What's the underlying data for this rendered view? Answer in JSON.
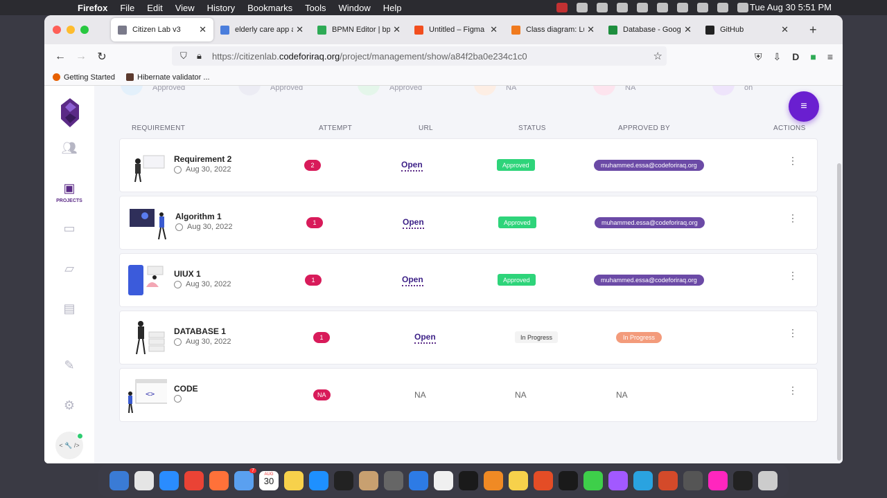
{
  "menubar": {
    "app": "Firefox",
    "items": [
      "File",
      "Edit",
      "View",
      "History",
      "Bookmarks",
      "Tools",
      "Window",
      "Help"
    ],
    "clock": "Tue Aug 30  5:51 PM"
  },
  "tabs": [
    {
      "label": "Citizen Lab v3",
      "color": "#7a7a8a",
      "active": true
    },
    {
      "label": "elderly care app an",
      "color": "#4a7ddc"
    },
    {
      "label": "BPMN Editor | bpm",
      "color": "#2eaa55"
    },
    {
      "label": "Untitled – Figma",
      "color": "#f24e1e"
    },
    {
      "label": "Class diagram: Luc",
      "color": "#f07a1e"
    },
    {
      "label": "Database - Google",
      "color": "#1e8e3e"
    },
    {
      "label": "GitHub",
      "color": "#222222"
    }
  ],
  "url": {
    "prefix": "https://citizenlab.",
    "domain": "codeforiraq.org",
    "path": "/project/management/show/a84f2ba0e234c1c0"
  },
  "bookmarks": [
    "Getting Started",
    "Hibernate validator ..."
  ],
  "sidebar": {
    "active_label": "PROJECTS"
  },
  "avatar_text": "< 🔧 />",
  "topstrip": [
    "Approved",
    "Approved",
    "Approved",
    "NA",
    "NA",
    "on"
  ],
  "table": {
    "headers": [
      "REQUIREMENT",
      "ATTEMPT",
      "URL",
      "STATUS",
      "APPROVED BY",
      "ACTIONS"
    ],
    "rows": [
      {
        "name": "Requirement 2",
        "date": "Aug 30, 2022",
        "attempt": "2",
        "url": "Open",
        "status": "Approved",
        "status_type": "approved",
        "approved_by": "muhammed.essa@codeforiraq.org",
        "approver_type": "email"
      },
      {
        "name": "Algorithm 1",
        "date": "Aug 30, 2022",
        "attempt": "1",
        "url": "Open",
        "status": "Approved",
        "status_type": "approved",
        "approved_by": "muhammed.essa@codeforiraq.org",
        "approver_type": "email"
      },
      {
        "name": "UIUX 1",
        "date": "Aug 30, 2022",
        "attempt": "1",
        "url": "Open",
        "status": "Approved",
        "status_type": "approved",
        "approved_by": "muhammed.essa@codeforiraq.org",
        "approver_type": "email"
      },
      {
        "name": "DATABASE 1",
        "date": "Aug 30, 2022",
        "attempt": "1",
        "url": "Open",
        "status": "In Progress",
        "status_type": "progress",
        "approved_by": "In Progress",
        "approver_type": "inprog"
      },
      {
        "name": "CODE",
        "date": "",
        "attempt": "NA",
        "url": "NA",
        "status": "NA",
        "status_type": "na",
        "approved_by": "NA",
        "approver_type": "na"
      }
    ]
  },
  "colors": {
    "accent": "#6a1fd0",
    "approved": "#2ed47a",
    "attempt": "#d81b5a",
    "approver": "#6b4aa6",
    "inprogress": "#f39b7b"
  },
  "dock": {
    "apps": [
      "#3a7bd5",
      "#e5e5e5",
      "#2a8cff",
      "#ea4335",
      "#ff7139",
      "#5aa0f0",
      "#ffffff",
      "#f7d14b",
      "#1e90ff",
      "#222222",
      "#c8a070",
      "#666666",
      "#2d7be5",
      "#f0f0f0",
      "#1a1a1a",
      "#f08a24",
      "#f7d14b",
      "#e44d26",
      "#1a1a1a",
      "#3ecf4a",
      "#a259ff",
      "#2aa3e0",
      "#d44a2a",
      "#555555",
      "#ff26be",
      "#222222",
      "#cccccc"
    ],
    "mail_badge": "7",
    "calendar_month": "AUG",
    "calendar_day": "30"
  }
}
